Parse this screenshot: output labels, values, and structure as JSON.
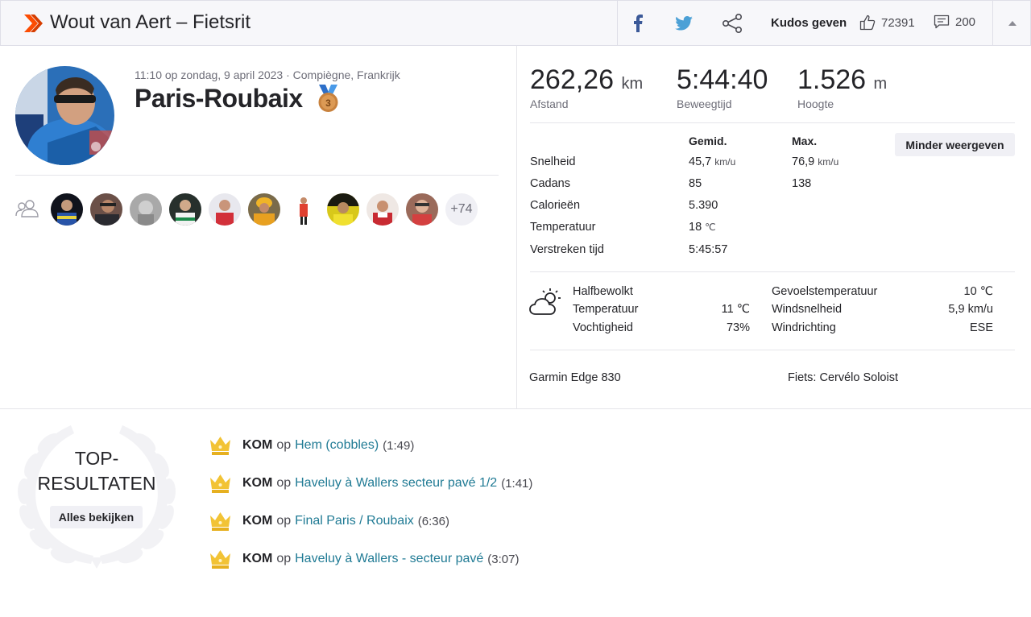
{
  "header": {
    "title": "Wout van Aert – Fietsrit",
    "kudos_label": "Kudos geven",
    "kudos_count": "72391",
    "comment_count": "200"
  },
  "activity": {
    "datetime_location": "11:10 op zondag, 9 april 2023 · Compiègne, Frankrijk",
    "name": "Paris-Roubaix",
    "medal_rank": "3",
    "more_athletes": "+74"
  },
  "stats": {
    "distance_value": "262,26",
    "distance_unit": "km",
    "distance_label": "Afstand",
    "moving_time_value": "5:44:40",
    "moving_time_label": "Beweegtijd",
    "elevation_value": "1.526",
    "elevation_unit": "m",
    "elevation_label": "Hoogte"
  },
  "more_stats": {
    "col_avg": "Gemid.",
    "col_max": "Max.",
    "toggle_label": "Minder weergeven",
    "rows": [
      {
        "label": "Snelheid",
        "avg": "45,7",
        "avg_unit": "km/u",
        "max": "76,9",
        "max_unit": "km/u"
      },
      {
        "label": "Cadans",
        "avg": "85",
        "avg_unit": "",
        "max": "138",
        "max_unit": ""
      },
      {
        "label": "Calorieën",
        "avg": "5.390",
        "avg_unit": "",
        "max": "",
        "max_unit": ""
      },
      {
        "label": "Temperatuur",
        "avg": "18",
        "avg_unit": "℃",
        "max": "",
        "max_unit": ""
      },
      {
        "label": "Verstreken tijd",
        "avg": "5:45:57",
        "avg_unit": "",
        "max": "",
        "max_unit": ""
      }
    ]
  },
  "weather": {
    "condition": "Halfbewolkt",
    "temp_label": "Temperatuur",
    "temp_value": "11 ℃",
    "humidity_label": "Vochtigheid",
    "humidity_value": "73%",
    "feels_label": "Gevoelstemperatuur",
    "feels_value": "10 ℃",
    "wind_speed_label": "Windsnelheid",
    "wind_speed_value": "5,9 km/u",
    "wind_dir_label": "Windrichting",
    "wind_dir_value": "ESE"
  },
  "gear": {
    "device": "Garmin Edge 830",
    "bike": "Fiets: Cervélo Soloist"
  },
  "top_results": {
    "title_line1": "TOP-",
    "title_line2": "RESULTATEN",
    "see_all": "Alles bekijken",
    "items": [
      {
        "achievement": "KOM",
        "connector": "op",
        "segment": "Hem (cobbles)",
        "time": "(1:49)"
      },
      {
        "achievement": "KOM",
        "connector": "op",
        "segment": "Haveluy à Wallers secteur pavé 1/2",
        "time": "(1:41)"
      },
      {
        "achievement": "KOM",
        "connector": "op",
        "segment": "Final Paris / Roubaix",
        "time": "(6:36)"
      },
      {
        "achievement": "KOM",
        "connector": "op",
        "segment": "Haveluy à Wallers - secteur pavé",
        "time": "(3:07)"
      }
    ]
  },
  "colors": {
    "brand": "#fc4c02",
    "segment_link": "#1f7a94",
    "crown": "#f2c335"
  }
}
